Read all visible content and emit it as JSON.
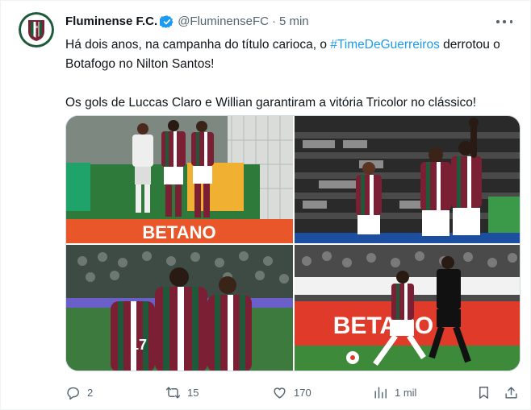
{
  "author": {
    "name": "Fluminense F.C.",
    "handle": "@FluminenseFC",
    "separator": "·",
    "time": "5 min"
  },
  "tweet": {
    "line1_before": "Há dois anos, na campanha do título carioca, o ",
    "hashtag": "#TimeDeGuerreiros",
    "line1_after": " derrotou o Botafogo no Nilton Santos!",
    "line2": "Os gols de Luccas Claro e Willian garantiram a vitória Tricolor no clássico!"
  },
  "media": {
    "photos": [
      {
        "icon": "team-celebration-photo",
        "ad_text": "BETANO"
      },
      {
        "icon": "players-celebrating-photo",
        "ad_text": ""
      },
      {
        "icon": "team-huddle-photo",
        "ad_text": ""
      },
      {
        "icon": "match-action-photo",
        "ad_text": "BETANO"
      }
    ]
  },
  "actions": {
    "replies": "2",
    "retweets": "15",
    "likes": "170",
    "views": "1 mil"
  },
  "colors": {
    "text": "#0f1419",
    "secondary": "#536471",
    "link": "#1d9bf0",
    "verified": "#1d9bf0",
    "club_maroon": "#7a1f34",
    "club_green": "#1e5a3a"
  }
}
